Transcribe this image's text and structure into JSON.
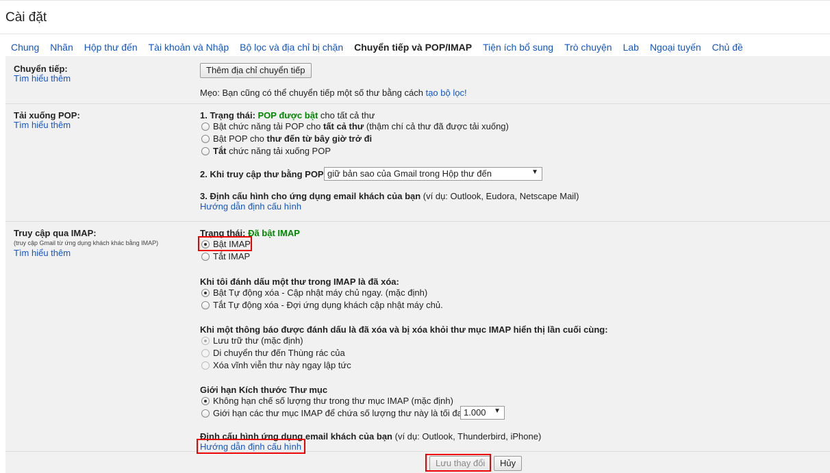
{
  "page_title": "Cài đặt",
  "tabs": [
    {
      "label": "Chung",
      "active": false
    },
    {
      "label": "Nhãn",
      "active": false
    },
    {
      "label": "Hộp thư đến",
      "active": false
    },
    {
      "label": "Tài khoản và Nhập",
      "active": false
    },
    {
      "label": "Bộ lọc và địa chỉ bị chặn",
      "active": false
    },
    {
      "label": "Chuyển tiếp và POP/IMAP",
      "active": true
    },
    {
      "label": "Tiện ích bổ sung",
      "active": false
    },
    {
      "label": "Trò chuyện",
      "active": false
    },
    {
      "label": "Lab",
      "active": false
    },
    {
      "label": "Ngoại tuyến",
      "active": false
    },
    {
      "label": "Chủ đề",
      "active": false
    }
  ],
  "forwarding": {
    "label": "Chuyển tiếp:",
    "learn_more": "Tìm hiểu thêm",
    "add_button": "Thêm địa chỉ chuyển tiếp",
    "tip_prefix": "Mẹo: Bạn cũng có thể chuyển tiếp một số thư bằng cách ",
    "tip_link": "tạo bộ lọc!"
  },
  "pop": {
    "label": "Tải xuống POP:",
    "learn_more": "Tìm hiểu thêm",
    "status_prefix": "1. Trạng thái: ",
    "status_value": "POP được bật",
    "status_suffix": " cho tất cả thư",
    "options": [
      {
        "pre": "Bật chức năng tải POP cho ",
        "bold": "tất cả thư",
        "post": " (thậm chí cả thư đã được tải xuống)",
        "selected": false
      },
      {
        "pre": "Bật POP cho ",
        "bold": "thư đến từ bây giờ trở đi",
        "post": "",
        "selected": false
      },
      {
        "pre": "",
        "bold": "Tắt",
        "post": " chức năng tải xuống POP",
        "selected": false
      }
    ],
    "access_label": "2. Khi truy cập thư bằng POP",
    "access_value": "giữ bản sao của Gmail trong Hộp thư đến",
    "config_label": "3. Định cấu hình cho ứng dụng email khách của bạn",
    "config_example": " (ví dụ: Outlook, Eudora, Netscape Mail)",
    "config_link": "Hướng dẫn định cấu hình"
  },
  "imap": {
    "label": "Truy cập qua IMAP:",
    "sublabel": "(truy cập Gmail từ ứng dụng khách khác bằng IMAP)",
    "learn_more": "Tìm hiểu thêm",
    "status_prefix": "Trạng thái: ",
    "status_value": "Đã bật IMAP",
    "enable": {
      "label": "Bật IMAP",
      "selected": true
    },
    "disable": {
      "label": "Tắt IMAP",
      "selected": false
    },
    "delete_heading": "Khi tôi đánh dấu một thư trong IMAP là đã xóa:",
    "delete_options": [
      {
        "label": "Bật Tự động xóa - Cập nhật máy chủ ngay. (mặc định)",
        "selected": true
      },
      {
        "label": "Tắt Tự động xóa - Đợi ứng dụng khách cập nhật máy chủ.",
        "selected": false
      }
    ],
    "expunge_heading": "Khi một thông báo được đánh dấu là đã xóa và bị xóa khỏi thư mục IMAP hiển thị lần cuối cùng:",
    "expunge_options": [
      {
        "label": "Lưu trữ thư (mặc định)",
        "selected": true
      },
      {
        "label": "Di chuyển thư đến Thùng rác của",
        "selected": false
      },
      {
        "label": "Xóa vĩnh viễn thư này ngay lập tức",
        "selected": false
      }
    ],
    "folder_heading": "Giới hạn Kích thước Thư mục",
    "folder_options": [
      {
        "label": "Không hạn chế số lượng thư trong thư mục IMAP (mặc định)",
        "selected": true
      },
      {
        "label": "Giới hạn các thư mục IMAP để chứa số lượng thư này là tối đa",
        "selected": false
      }
    ],
    "folder_limit_value": "1.000",
    "config_label": "Định cấu hình ứng dụng email khách của bạn",
    "config_example": " (ví dụ: Outlook, Thunderbird, iPhone)",
    "config_link": "Hướng dẫn định cấu hình"
  },
  "footer": {
    "save_label": "Lưu thay đổi",
    "cancel_label": "Hủy"
  },
  "colors": {
    "link": "#1155cc",
    "status_green": "#008000",
    "highlight": "#ee0000",
    "panel_bg": "#f1f1f1"
  }
}
